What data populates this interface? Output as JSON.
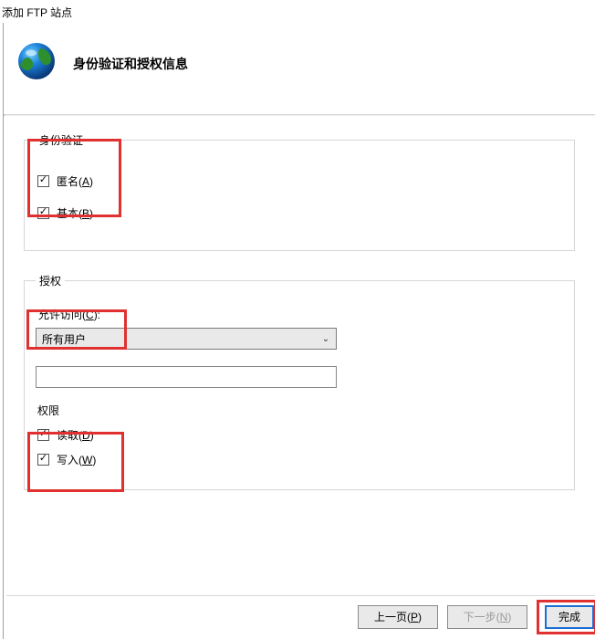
{
  "window": {
    "title": "添加 FTP 站点"
  },
  "header": {
    "title": "身份验证和授权信息"
  },
  "auth_group": {
    "legend": "身份验证",
    "anonymous": {
      "label": "匿名",
      "hotkey": "A",
      "checked": true
    },
    "basic": {
      "label": "基本",
      "hotkey": "B",
      "checked": true
    }
  },
  "authz_group": {
    "legend": "授权",
    "allow_access_label": "允许访问",
    "allow_access_hotkey": "C",
    "allow_access_selected": "所有用户",
    "textbox_value": "",
    "perm_legend": "权限",
    "read": {
      "label": "读取",
      "hotkey": "D",
      "checked": true
    },
    "write": {
      "label": "写入",
      "hotkey": "W",
      "checked": true
    }
  },
  "buttons": {
    "prev": {
      "label": "上一页",
      "hotkey": "P"
    },
    "next": {
      "label": "下一步",
      "hotkey": "N"
    },
    "finish": {
      "label": "完成"
    }
  },
  "icons": {
    "combo_chevron": "⌄"
  }
}
